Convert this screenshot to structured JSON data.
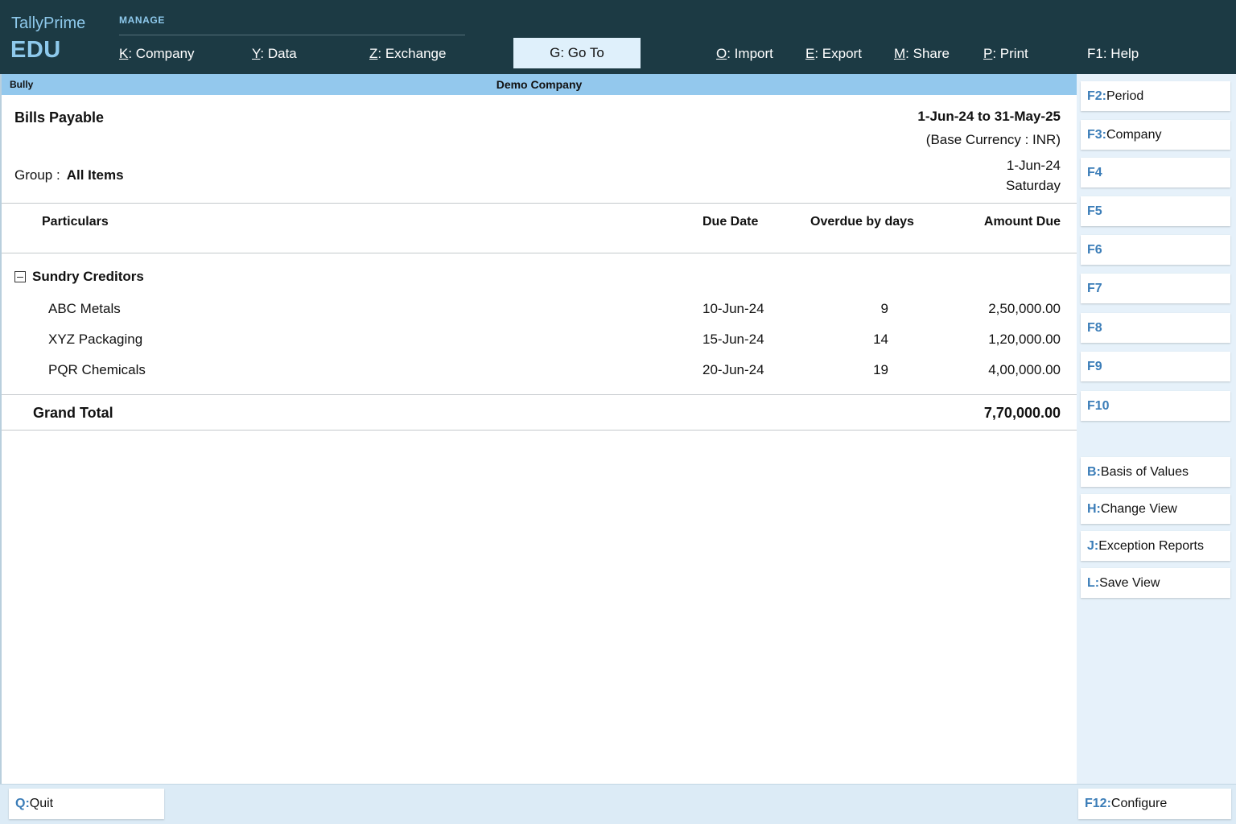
{
  "topbar": {
    "brand_line1": "TallyPrime",
    "brand_line2": "EDU",
    "section_label": "MANAGE",
    "menu": [
      {
        "key": "K",
        "label": ": Company"
      },
      {
        "key": "Y",
        "label": ": Data"
      },
      {
        "key": "Z",
        "label": ": Exchange"
      },
      {
        "key": "G",
        "label": ": Go To"
      },
      {
        "key": "O",
        "label": ": Import"
      },
      {
        "key": "E",
        "label": ": Export"
      },
      {
        "key": "M",
        "label": ": Share"
      },
      {
        "key": "P",
        "label": ": Print"
      },
      {
        "key": "F1",
        "label": ": Help"
      }
    ]
  },
  "titlebar": {
    "left": "Bully",
    "center": "Demo Company"
  },
  "report": {
    "title": "Bills Payable",
    "period": "1-Jun-24 to 31-May-25",
    "currency": "(Base Currency : INR)",
    "group_label": "Group  :",
    "group_value": "All Items",
    "date": "1-Jun-24",
    "day": "Saturday",
    "columns": {
      "particulars": "Particulars",
      "due_date": "Due Date",
      "overdue": "Overdue by days",
      "amount": "Amount Due"
    },
    "group_name": "Sundry Creditors",
    "rows": [
      {
        "name": "ABC Metals",
        "due_date": "10-Jun-24",
        "overdue": "9",
        "amount": "2,50,000.00"
      },
      {
        "name": "XYZ Packaging",
        "due_date": "15-Jun-24",
        "overdue": "14",
        "amount": "1,20,000.00"
      },
      {
        "name": "PQR Chemicals",
        "due_date": "20-Jun-24",
        "overdue": "19",
        "amount": "4,00,000.00"
      }
    ],
    "grand_total_label": "Grand Total",
    "grand_total_value": "7,70,000.00"
  },
  "sidebar": {
    "buttons": [
      {
        "key": "F2:",
        "label": " Period"
      },
      {
        "key": "F3:",
        "label": " Company"
      },
      {
        "key": "F4",
        "label": ""
      },
      {
        "key": "F5",
        "label": ""
      },
      {
        "key": "F6",
        "label": ""
      },
      {
        "key": "F7",
        "label": ""
      },
      {
        "key": "F8",
        "label": ""
      },
      {
        "key": "F9",
        "label": ""
      },
      {
        "key": "F10",
        "label": ""
      },
      {
        "key": "B:",
        "label": " Basis of Values"
      },
      {
        "key": "H:",
        "label": " Change View"
      },
      {
        "key": "J:",
        "label": " Exception Reports"
      },
      {
        "key": "L:",
        "label": " Save View"
      }
    ]
  },
  "bottom": {
    "quit_key": "Q:",
    "quit_label": " Quit",
    "configure_key": "F12:",
    "configure_label": " Configure"
  },
  "colors": {
    "topbar_bg": "#1c3a44",
    "titlebar_bg": "#93c8ed",
    "key_accent": "#3b7db8",
    "side_bg": "#e6f1fa"
  }
}
